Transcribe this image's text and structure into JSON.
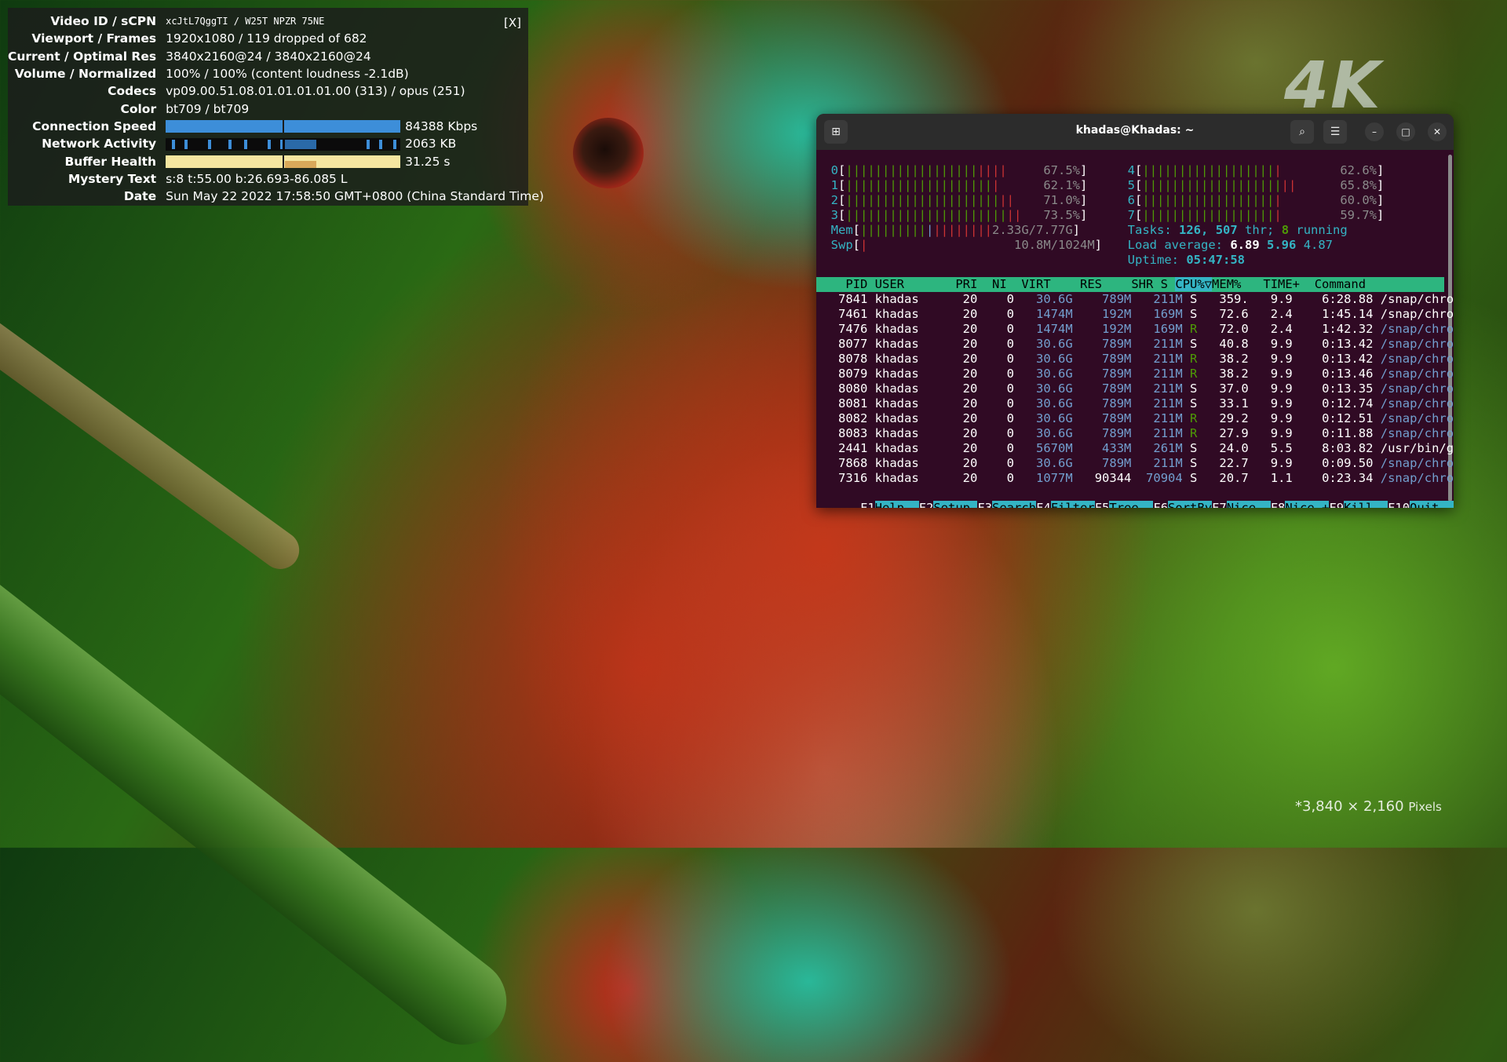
{
  "background": {
    "logo_text": "4K",
    "resolution_caption": "*3,840 × 2,160",
    "resolution_unit": "Pixels"
  },
  "stats": {
    "close_label": "[X]",
    "rows": [
      {
        "key": "Video ID / sCPN",
        "value": "xcJtL7QggTI / W25T NPZR 75NE"
      },
      {
        "key": "Viewport / Frames",
        "value": "1920x1080 / 119 dropped of 682"
      },
      {
        "key": "Current / Optimal Res",
        "value": "3840x2160@24 / 3840x2160@24"
      },
      {
        "key": "Volume / Normalized",
        "value": "100% / 100% (content loudness -2.1dB)"
      },
      {
        "key": "Codecs",
        "value": "vp09.00.51.08.01.01.01.01.00 (313) / opus (251)"
      },
      {
        "key": "Color",
        "value": "bt709 / bt709"
      },
      {
        "key": "Connection Speed",
        "value": "84388 Kbps"
      },
      {
        "key": "Network Activity",
        "value": "2063 KB"
      },
      {
        "key": "Buffer Health",
        "value": "31.25 s"
      },
      {
        "key": "Mystery Text",
        "value": "s:8 t:55.00 b:26.693-86.085 L"
      },
      {
        "key": "Date",
        "value": "Sun May 22 2022 17:58:50 GMT+0800 (China Standard Time)"
      }
    ]
  },
  "terminal": {
    "title": "khadas@Khadas: ~",
    "buttons": {
      "new_tab": "⊞",
      "search": "⌕",
      "menu": "☰",
      "minimize": "–",
      "maximize": "□",
      "close": "✕"
    },
    "cpus": [
      {
        "id": "0",
        "pct": "67.5%"
      },
      {
        "id": "1",
        "pct": "62.1%"
      },
      {
        "id": "2",
        "pct": "71.0%"
      },
      {
        "id": "3",
        "pct": "73.5%"
      },
      {
        "id": "4",
        "pct": "62.6%"
      },
      {
        "id": "5",
        "pct": "65.8%"
      },
      {
        "id": "6",
        "pct": "60.0%"
      },
      {
        "id": "7",
        "pct": "59.7%"
      }
    ],
    "mem_label": "Mem",
    "mem_value": "2.33G/7.77G",
    "swp_label": "Swp",
    "swp_value": "10.8M/1024M",
    "tasks_label": "Tasks:",
    "tasks_count": "126,",
    "threads": "507",
    "thr_label": "thr;",
    "running_count": "8",
    "running_label": "running",
    "load_label": "Load average:",
    "load_1": "6.89",
    "load_5": "5.96",
    "load_15": "4.87",
    "uptime_label": "Uptime:",
    "uptime": "05:47:58",
    "columns": [
      "PID",
      "USER",
      "PRI",
      "NI",
      "VIRT",
      "RES",
      "SHR",
      "S",
      "CPU%▽",
      "MEM%",
      "TIME+",
      "Command"
    ],
    "processes": [
      {
        "pid": "7841",
        "user": "khadas",
        "pri": "20",
        "ni": "0",
        "virt": "30.6G",
        "res": "789M",
        "shr": "211M",
        "s": "S",
        "cpu": "359.",
        "mem": "9.9",
        "time": "6:28.88",
        "cmd": "/snap/chromium/"
      },
      {
        "pid": "7461",
        "user": "khadas",
        "pri": "20",
        "ni": "0",
        "virt": "1474M",
        "res": "192M",
        "shr": "169M",
        "s": "S",
        "cpu": "72.6",
        "mem": "2.4",
        "time": "1:45.14",
        "cmd": "/snap/chromium/"
      },
      {
        "pid": "7476",
        "user": "khadas",
        "pri": "20",
        "ni": "0",
        "virt": "1474M",
        "res": "192M",
        "shr": "169M",
        "s": "R",
        "cpu": "72.0",
        "mem": "2.4",
        "time": "1:42.32",
        "cmd": "/snap/chromium/"
      },
      {
        "pid": "8077",
        "user": "khadas",
        "pri": "20",
        "ni": "0",
        "virt": "30.6G",
        "res": "789M",
        "shr": "211M",
        "s": "S",
        "cpu": "40.8",
        "mem": "9.9",
        "time": "0:13.42",
        "cmd": "/snap/chromium/"
      },
      {
        "pid": "8078",
        "user": "khadas",
        "pri": "20",
        "ni": "0",
        "virt": "30.6G",
        "res": "789M",
        "shr": "211M",
        "s": "R",
        "cpu": "38.2",
        "mem": "9.9",
        "time": "0:13.42",
        "cmd": "/snap/chromium/"
      },
      {
        "pid": "8079",
        "user": "khadas",
        "pri": "20",
        "ni": "0",
        "virt": "30.6G",
        "res": "789M",
        "shr": "211M",
        "s": "R",
        "cpu": "38.2",
        "mem": "9.9",
        "time": "0:13.46",
        "cmd": "/snap/chromium/"
      },
      {
        "pid": "8080",
        "user": "khadas",
        "pri": "20",
        "ni": "0",
        "virt": "30.6G",
        "res": "789M",
        "shr": "211M",
        "s": "S",
        "cpu": "37.0",
        "mem": "9.9",
        "time": "0:13.35",
        "cmd": "/snap/chromium/"
      },
      {
        "pid": "8081",
        "user": "khadas",
        "pri": "20",
        "ni": "0",
        "virt": "30.6G",
        "res": "789M",
        "shr": "211M",
        "s": "S",
        "cpu": "33.1",
        "mem": "9.9",
        "time": "0:12.74",
        "cmd": "/snap/chromium/"
      },
      {
        "pid": "8082",
        "user": "khadas",
        "pri": "20",
        "ni": "0",
        "virt": "30.6G",
        "res": "789M",
        "shr": "211M",
        "s": "R",
        "cpu": "29.2",
        "mem": "9.9",
        "time": "0:12.51",
        "cmd": "/snap/chromium/"
      },
      {
        "pid": "8083",
        "user": "khadas",
        "pri": "20",
        "ni": "0",
        "virt": "30.6G",
        "res": "789M",
        "shr": "211M",
        "s": "R",
        "cpu": "27.9",
        "mem": "9.9",
        "time": "0:11.88",
        "cmd": "/snap/chromium/"
      },
      {
        "pid": "2441",
        "user": "khadas",
        "pri": "20",
        "ni": "0",
        "virt": "5670M",
        "res": "433M",
        "shr": "261M",
        "s": "S",
        "cpu": "24.0",
        "mem": "5.5",
        "time": "8:03.82",
        "cmd": "/usr/bin/gnome-"
      },
      {
        "pid": "7868",
        "user": "khadas",
        "pri": "20",
        "ni": "0",
        "virt": "30.6G",
        "res": "789M",
        "shr": "211M",
        "s": "S",
        "cpu": "22.7",
        "mem": "9.9",
        "time": "0:09.50",
        "cmd": "/snap/chromium/"
      },
      {
        "pid": "7316",
        "user": "khadas",
        "pri": "20",
        "ni": "0",
        "virt": "1077M",
        "res": "90344",
        "shr": "70904",
        "s": "S",
        "cpu": "20.7",
        "mem": "1.1",
        "time": "0:23.34",
        "cmd": "/snap/chromium/"
      }
    ],
    "fkeys": [
      {
        "key": "F1",
        "label": "Help  "
      },
      {
        "key": "F2",
        "label": "Setup "
      },
      {
        "key": "F3",
        "label": "Search"
      },
      {
        "key": "F4",
        "label": "Filter"
      },
      {
        "key": "F5",
        "label": "Tree  "
      },
      {
        "key": "F6",
        "label": "SortBy"
      },
      {
        "key": "F7",
        "label": "Nice -"
      },
      {
        "key": "F8",
        "label": "Nice +"
      },
      {
        "key": "F9",
        "label": "Kill  "
      },
      {
        "key": "F10",
        "label": "Quit  "
      }
    ],
    "colors": {
      "background": "#300a24",
      "header": "#2db57f",
      "highlight": "#34b4c4"
    }
  }
}
